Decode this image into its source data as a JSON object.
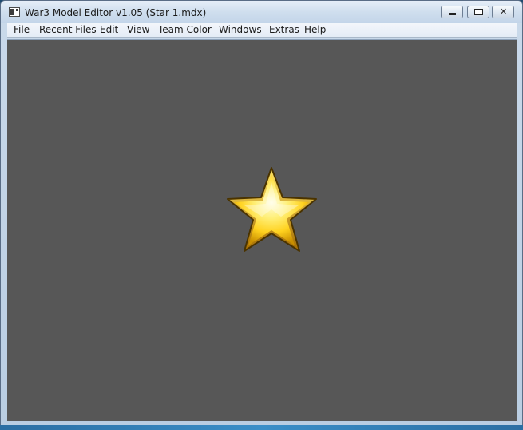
{
  "window": {
    "title": "War3 Model Editor v1.05 (Star 1.mdx)",
    "app_icon": "app-window-icon",
    "controls": {
      "minimize": "minimize-icon",
      "maximize": "maximize-icon",
      "close": "close-icon",
      "close_glyph": "✕"
    }
  },
  "menubar": {
    "items": [
      {
        "label": "File"
      },
      {
        "label": "Recent Files"
      },
      {
        "label": "Edit"
      },
      {
        "label": "View"
      },
      {
        "label": "Team Color"
      },
      {
        "label": "Windows"
      },
      {
        "label": "Extras"
      },
      {
        "label": "Help"
      }
    ]
  },
  "viewport": {
    "background_color": "#575757",
    "model": "star-model",
    "model_colors": {
      "highlight": "#fffde0",
      "mid": "#ffe04a",
      "shadow": "#c98f00",
      "outline": "#4a3300"
    }
  }
}
